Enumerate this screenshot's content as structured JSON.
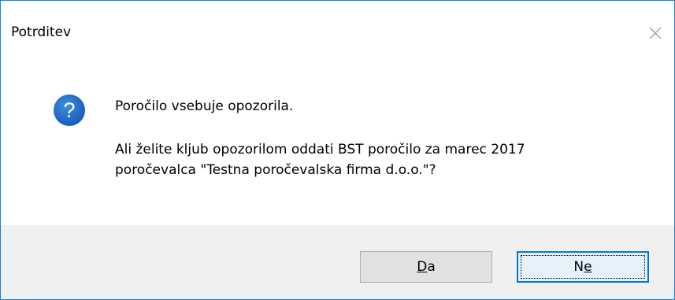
{
  "window": {
    "title": "Potrditev"
  },
  "icon": {
    "name": "question-icon",
    "glyph": "?",
    "color": "#1e6fc8"
  },
  "message": {
    "line1": "Poročilo vsebuje opozorila.",
    "line2": "Ali želite kljub opozorilom oddati BST poročilo za marec 2017",
    "line3": "poročevalca \"Testna poročevalska firma d.o.o.\"?"
  },
  "buttons": {
    "yes": {
      "mnemonic": "D",
      "rest": "a"
    },
    "no": {
      "prefix": "N",
      "mnemonic": "e"
    }
  },
  "colors": {
    "window_border": "#1883d7",
    "footer_bg": "#f0f0f0",
    "default_button_border": "#0078d7"
  }
}
